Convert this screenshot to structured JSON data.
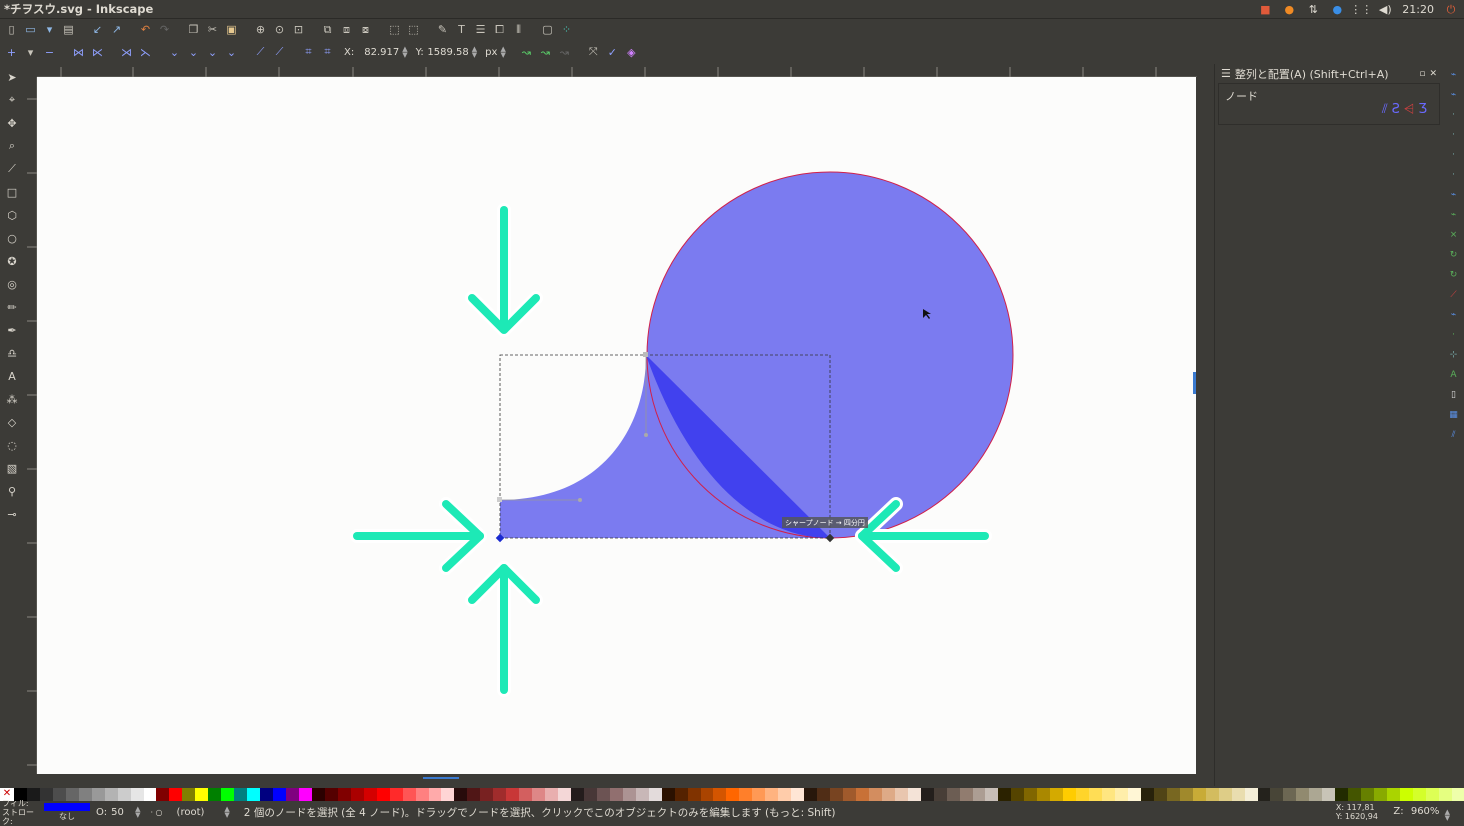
{
  "window": {
    "title": "*チヲスウ.svg - Inkscape"
  },
  "system_tray": {
    "time": "21:20"
  },
  "toolbar": {
    "x_label": "X:",
    "x_value": "82.917",
    "y_label": "Y:",
    "y_value": "1589.58",
    "unit": "px"
  },
  "dock": {
    "title": "整列と配置(A) (Shift+Ctrl+A)",
    "section": "ノード"
  },
  "canvas": {
    "tooltip": "シャープノード → 四分円",
    "accent_color": "#7b7bf0",
    "arrow_color": "#1de9b6"
  },
  "status": {
    "fill_label": "フィル:",
    "stroke_label": "ストローク:",
    "stroke_value": "なし",
    "opacity_label": "O:",
    "opacity_value": "50",
    "layer": "(root)",
    "message": "2 個のノードを選択 (全 4 ノード)。ドラッグでノードを選択、クリックでこのオブジェクトのみを編集します (もっと: Shift)",
    "cursor_x": "X: 117,81",
    "cursor_y": "Y: 1620,94",
    "zoom_label": "Z:",
    "zoom_value": "960%"
  },
  "palette_colors": [
    "#000000",
    "#1a1a1a",
    "#333333",
    "#4d4d4d",
    "#666666",
    "#808080",
    "#999999",
    "#b3b3b3",
    "#cccccc",
    "#e6e6e6",
    "#ffffff",
    "#800000",
    "#ff0000",
    "#808000",
    "#ffff00",
    "#008000",
    "#00ff00",
    "#008080",
    "#00ffff",
    "#000080",
    "#0000ff",
    "#800080",
    "#ff00ff",
    "#2b0000",
    "#550000",
    "#800000",
    "#aa0000",
    "#d40000",
    "#ff0000",
    "#ff2a2a",
    "#ff5555",
    "#ff8080",
    "#ffaaaa",
    "#ffd5d5",
    "#280b0b",
    "#501616",
    "#782121",
    "#a02c2c",
    "#c83737",
    "#d35f5f",
    "#de8787",
    "#e9afaf",
    "#f4d7d7",
    "#241c1c",
    "#483737",
    "#6c5353",
    "#916f6f",
    "#ac9393",
    "#c8b7b7",
    "#e3dbdb",
    "#2b1100",
    "#552200",
    "#803300",
    "#aa4400",
    "#d45500",
    "#ff6600",
    "#ff7f2a",
    "#ff9955",
    "#ffb380",
    "#ffccaa",
    "#ffe6d5",
    "#28170b",
    "#502d16",
    "#784421",
    "#a05a2c",
    "#c87137",
    "#d38d5f",
    "#deaa87",
    "#e9c6af",
    "#f4e3d7",
    "#241f1c",
    "#483e37",
    "#6c5d53",
    "#917c6f",
    "#ac9d93",
    "#c8beb7",
    "#2b2200",
    "#554400",
    "#806600",
    "#aa8800",
    "#d4aa00",
    "#ffcc00",
    "#ffd42a",
    "#ffdd55",
    "#ffe680",
    "#ffeeaa",
    "#fff6d5",
    "#28220b",
    "#504416",
    "#786721",
    "#a0892c",
    "#c8ab37",
    "#d3bc5f",
    "#decd87",
    "#e9ddaf",
    "#f4eed7",
    "#24221c",
    "#484537",
    "#6c6753",
    "#918a6f",
    "#aca793",
    "#c8c4b7",
    "#222b00",
    "#445500",
    "#668000",
    "#88aa00",
    "#aad400",
    "#ccff00",
    "#d4ff2a",
    "#ddff55",
    "#e5ff80",
    "#eeffaa"
  ]
}
